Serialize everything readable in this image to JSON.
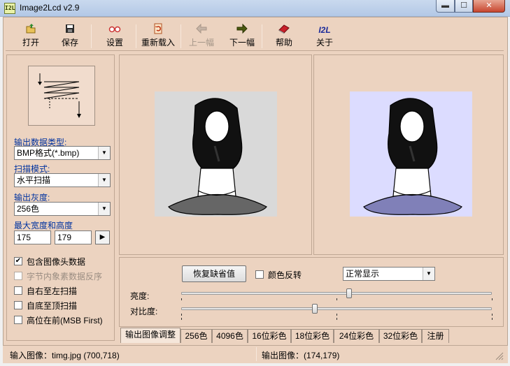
{
  "window": {
    "title": "Image2Lcd v2.9",
    "icon_text": "I2L",
    "min_glyph": "▬",
    "max_glyph": "☐",
    "close_glyph": "✕"
  },
  "toolbar": {
    "open": "打开",
    "save": "保存",
    "settings": "设置",
    "reload": "重新载入",
    "prev": "上一幅",
    "next": "下一幅",
    "help": "帮助",
    "about": "关于",
    "about_icon_text": "I2L"
  },
  "left": {
    "output_type_label": "输出数据类型:",
    "output_type_value": "BMP格式(*.bmp)",
    "scan_mode_label": "扫描模式:",
    "scan_mode_value": "水平扫描",
    "gray_label": "输出灰度:",
    "gray_value": "256色",
    "maxsize_label": "最大宽度和高度",
    "max_width": "175",
    "max_height": "179",
    "checks": [
      {
        "label": "包含图像头数据",
        "checked": true,
        "enabled": true
      },
      {
        "label": "字节内象素数据反序",
        "checked": false,
        "enabled": false
      },
      {
        "label": "自右至左扫描",
        "checked": false,
        "enabled": true
      },
      {
        "label": "自底至顶扫描",
        "checked": false,
        "enabled": true
      },
      {
        "label": "高位在前(MSB First)",
        "checked": false,
        "enabled": true
      }
    ]
  },
  "controls": {
    "restore_default": "恢复缺省值",
    "invert_label": "颜色反转",
    "display_mode": "正常显示",
    "brightness_label": "亮度:",
    "contrast_label": "对比度:",
    "brightness_value": 0.54,
    "contrast_value": 0.43
  },
  "tabs": [
    "输出图像调整",
    "256色",
    "4096色",
    "16位彩色",
    "18位彩色",
    "24位彩色",
    "32位彩色",
    "注册"
  ],
  "status": {
    "input": "输入图像：timg.jpg (700,718)",
    "output": "输出图像：(174,179)"
  },
  "colors": {
    "panel": "#ecd3c0",
    "left_image_bg": "#d9d9d9",
    "right_image_bg": "#dcdcff",
    "label_blue": "#0033a0"
  }
}
